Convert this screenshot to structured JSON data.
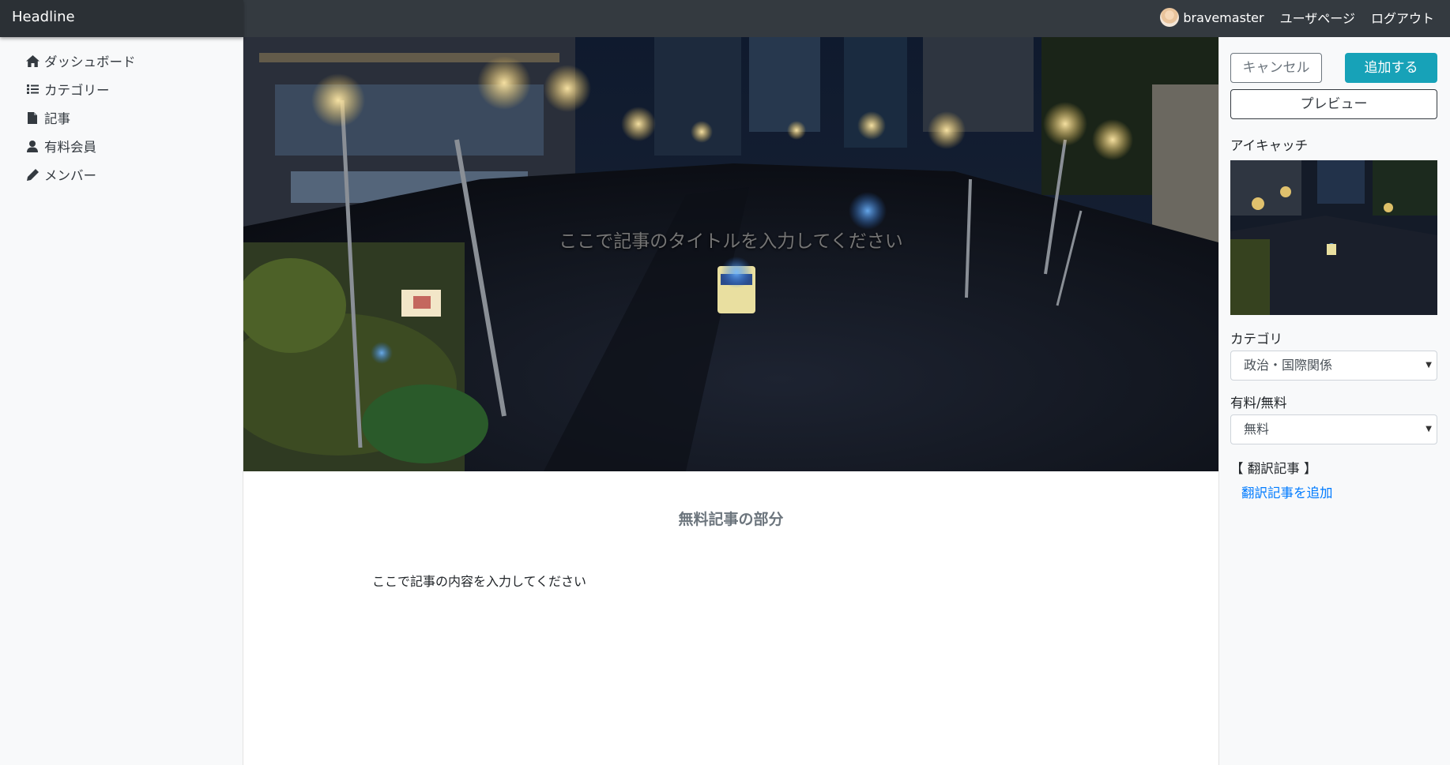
{
  "app": {
    "brand": "Headline"
  },
  "topnav": {
    "username": "bravemaster",
    "user_page": "ユーザページ",
    "logout": "ログアウト"
  },
  "sidebar": {
    "items": [
      {
        "label": "ダッシュボード",
        "icon": "home-icon"
      },
      {
        "label": "カテゴリー",
        "icon": "list-icon"
      },
      {
        "label": "記事",
        "icon": "file-icon"
      },
      {
        "label": "有料会員",
        "icon": "user-icon"
      },
      {
        "label": "メンバー",
        "icon": "pencil-icon"
      }
    ]
  },
  "main": {
    "title_placeholder": "ここで記事のタイトルを入力してください",
    "section_heading": "無料記事の部分",
    "body_placeholder": "ここで記事の内容を入力してください"
  },
  "panel": {
    "cancel": "キャンセル",
    "add": "追加する",
    "preview": "プレビュー",
    "eyecatch_label": "アイキャッチ",
    "category_label": "カテゴリ",
    "category_value": "政治・国際関係",
    "paid_label": "有料/無料",
    "paid_value": "無料",
    "translation_label": "【 翻訳記事 】",
    "add_translation": "翻訳記事を追加"
  },
  "colors": {
    "accent": "#17a2b8",
    "topbar": "#343a40",
    "link": "#007bff"
  }
}
